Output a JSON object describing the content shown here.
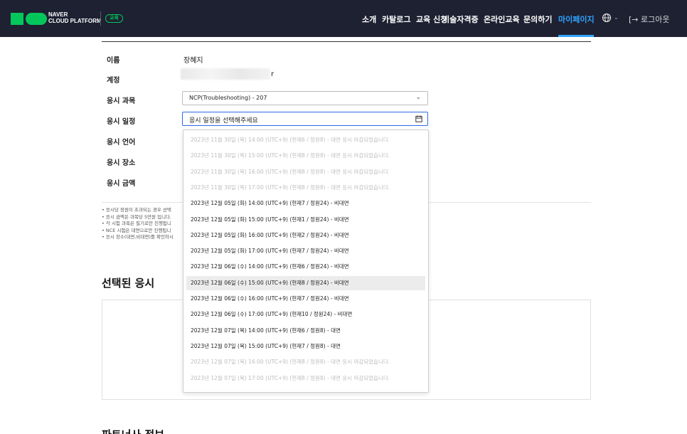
{
  "header": {
    "logo_line1": "NAVER",
    "logo_line2": "CLOUD PLATFORM",
    "badge": "교육",
    "nav": [
      "소개",
      "카탈로그",
      "교육 신청",
      "기술자격증",
      "온라인교육",
      "문의하기",
      "마이페이지"
    ],
    "active_nav": "마이페이지",
    "logout": "[→ 로그아웃",
    "brand_color": "#03c75a",
    "accent_color": "#2fa4ff"
  },
  "form": {
    "name_label": "이름",
    "name_value": "장혜지",
    "account_label": "계정",
    "account_tail": "r",
    "course_label": "응시 과목",
    "course_value": "NCP(Troubleshooting) - 207",
    "schedule_label": "응시 일정",
    "schedule_placeholder": "응시 일정을 선택해주세요",
    "language_label": "응시 언어",
    "location_label": "응시 장소",
    "fee_label": "응시 금액"
  },
  "notes": [
    "• 응시당 정원이 초과되는 경우 선택",
    "• 응시 금액은 과목당 5만원 입니다.",
    "• 각 시험 과목은 필기로만 진행됩니",
    "• NCE 시험은 대면으로만 진행됩니",
    "• 응시 장소(대면,비대면)를 확인하시"
  ],
  "selected_section_title": "선택된 응시",
  "partner_section_title": "파트너사 정보",
  "dropdown": {
    "options": [
      {
        "label": "2023년 11월 30일 (목) 14:00 (UTC+9) (현재6 / 정원8) - 대면 응시 마감되었습니다.",
        "disabled": true
      },
      {
        "label": "2023년 11월 30일 (목) 15:00 (UTC+9) (현재8 / 정원8) - 대면 응시 마감되었습니다.",
        "disabled": true
      },
      {
        "label": "2023년 11월 30일 (목) 16:00 (UTC+9) (현재8 / 정원8) - 대면 응시 마감되었습니다.",
        "disabled": true
      },
      {
        "label": "2023년 11월 30일 (목) 17:00 (UTC+9) (현재8 / 정원8) - 대면 응시 마감되었습니다.",
        "disabled": true
      },
      {
        "label": "2023년 12월 05일 (화) 14:00 (UTC+9) (현재7 / 정원24) - 비대면",
        "disabled": false
      },
      {
        "label": "2023년 12월 05일 (화) 15:00 (UTC+9) (현재1 / 정원24) - 비대면",
        "disabled": false
      },
      {
        "label": "2023년 12월 05일 (화) 16:00 (UTC+9) (현재2 / 정원24) - 비대면",
        "disabled": false
      },
      {
        "label": "2023년 12월 05일 (화) 17:00 (UTC+9) (현재7 / 정원24) - 비대면",
        "disabled": false
      },
      {
        "label": "2023년 12월 06일 (수) 14:00 (UTC+9) (현재6 / 정원24) - 비대면",
        "disabled": false
      },
      {
        "label": "2023년 12월 06일 (수) 15:00 (UTC+9) (현재8 / 정원24) - 비대면",
        "disabled": false,
        "hover": true
      },
      {
        "label": "2023년 12월 06일 (수) 16:00 (UTC+9) (현재7 / 정원24) - 비대면",
        "disabled": false
      },
      {
        "label": "2023년 12월 06일 (수) 17:00 (UTC+9) (현재10 / 정원24) - 비대면",
        "disabled": false
      },
      {
        "label": "2023년 12월 07일 (목) 14:00 (UTC+9) (현재6 / 정원8) - 대면",
        "disabled": false
      },
      {
        "label": "2023년 12월 07일 (목) 15:00 (UTC+9) (현재7 / 정원8) - 대면",
        "disabled": false
      },
      {
        "label": "2023년 12월 07일 (목) 16:00 (UTC+9) (현재8 / 정원8) - 대면 응시 마감되었습니다.",
        "disabled": true
      },
      {
        "label": "2023년 12월 07일 (목) 17:00 (UTC+9) (현재8 / 정원8) - 대면 응시 마감되었습니다.",
        "disabled": true
      }
    ]
  }
}
